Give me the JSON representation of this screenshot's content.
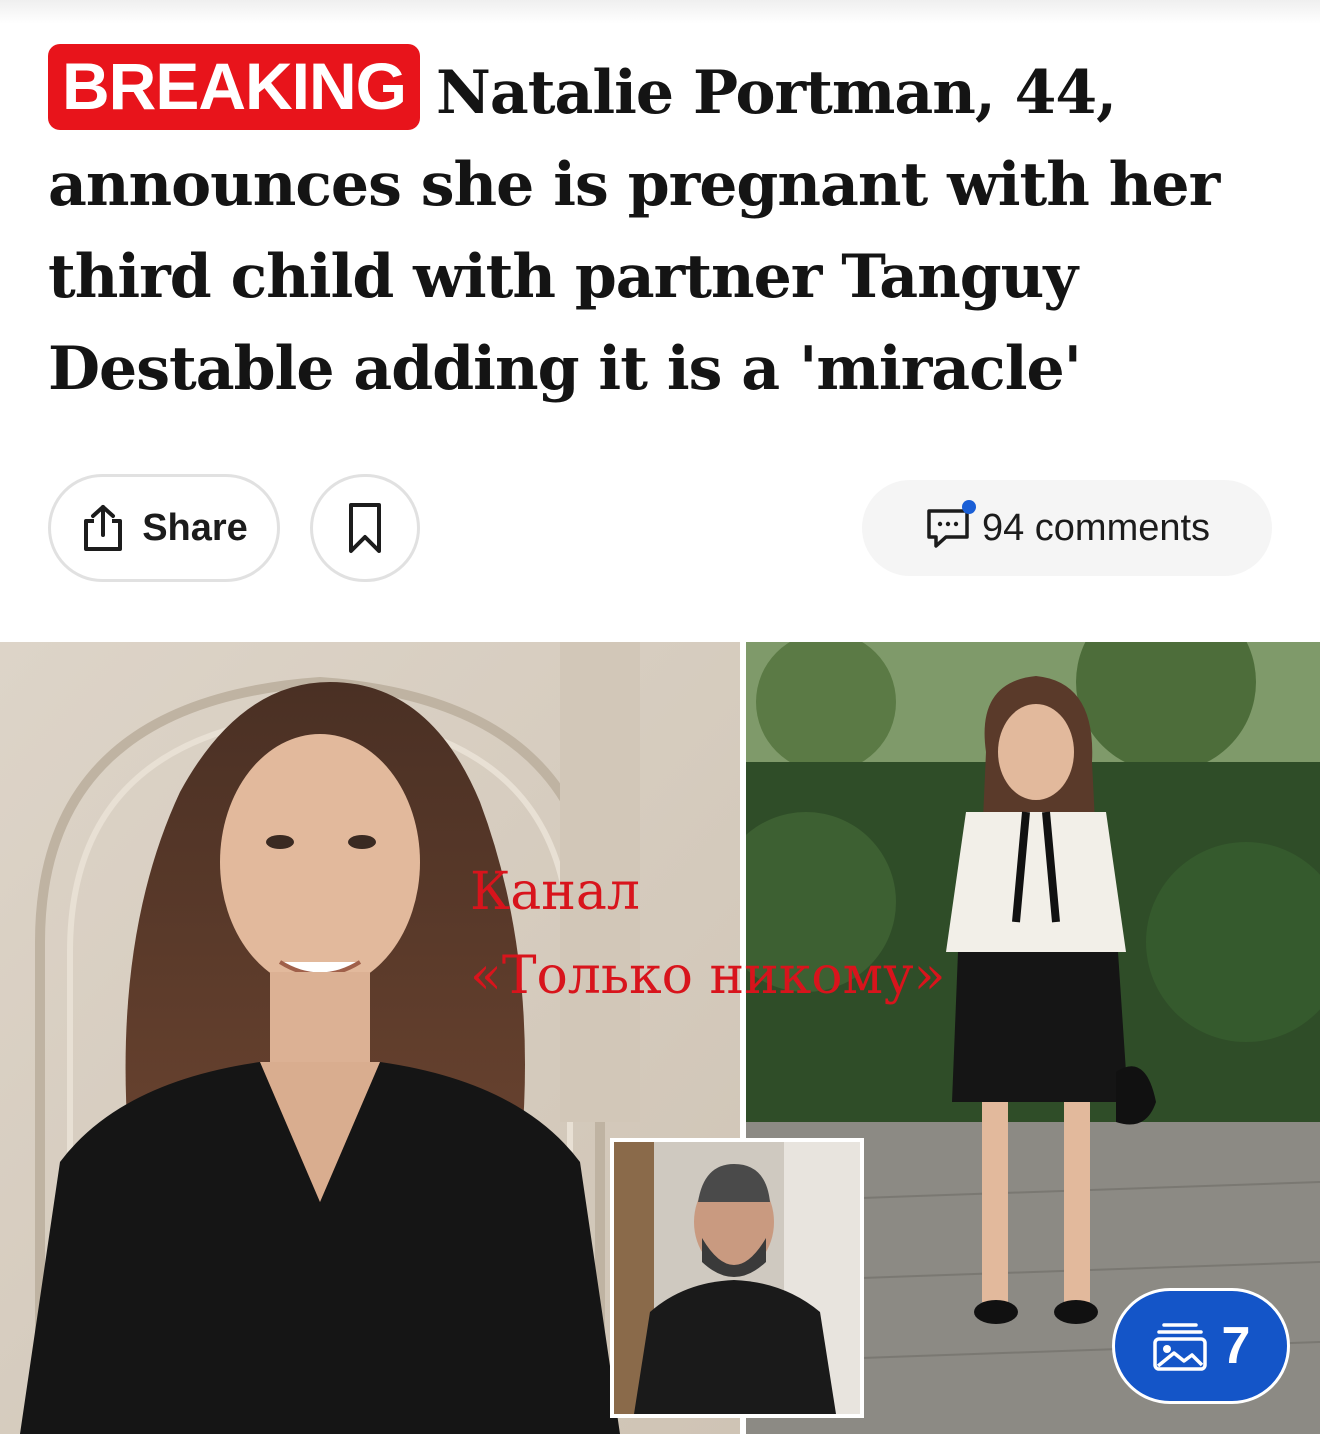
{
  "article": {
    "badge": "BREAKING",
    "headline": "Natalie Portman, 44, announces she is pregnant with her third child with partner Tanguy Destable adding it is a 'miracle'"
  },
  "actions": {
    "share_label": "Share",
    "share_icon": "share-icon",
    "bookmark_icon": "bookmark-icon",
    "comments_label": "94 comments",
    "comments_icon": "comment-bubble-icon"
  },
  "gallery": {
    "watermark_text": "Канал\n«Только никому»",
    "photo_count": "7",
    "count_icon": "gallery-images-icon"
  },
  "colors": {
    "breaking_red": "#e8141b",
    "gallery_badge_blue": "#1455c8",
    "notification_dot": "#1a5fd6",
    "watermark_red": "#d8141c"
  }
}
